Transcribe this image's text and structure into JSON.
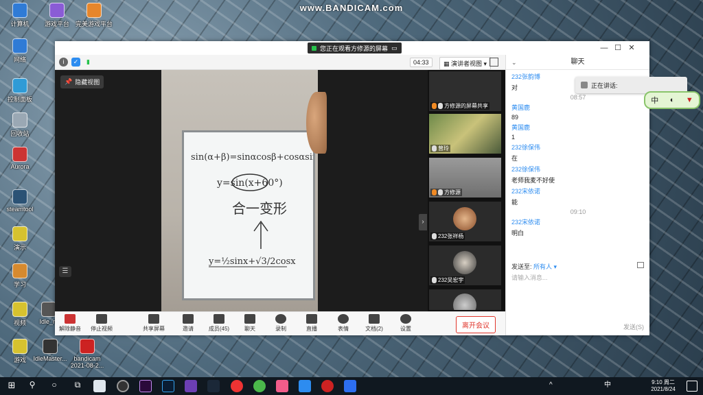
{
  "watermark": "www.BANDICAM.com",
  "desktop": {
    "icons": [
      {
        "label": "计算机",
        "color": "#2f7bd6"
      },
      {
        "label": "游戏平台",
        "color": "#8a5cd6"
      },
      {
        "label": "完美游戏平台",
        "color": "#e6862c"
      },
      {
        "label": "网络",
        "color": "#2f7bd6"
      },
      {
        "label": "控制面板",
        "color": "#2f9bd6"
      },
      {
        "label": "回收站",
        "color": "#9aa8b4"
      },
      {
        "label": "Aurora",
        "color": "#cc3333"
      },
      {
        "label": "steamtool",
        "color": "#2b5275"
      },
      {
        "label": "演示",
        "color": "#d6c22f"
      },
      {
        "label": "学习",
        "color": "#d68a2f"
      },
      {
        "label": "视频",
        "color": "#d6c22f"
      },
      {
        "label": "游戏",
        "color": "#d6c22f"
      },
      {
        "label": "Idle_m",
        "color": "#555555"
      },
      {
        "label": "IdleMaster...",
        "color": "#333333"
      },
      {
        "label": "bandicam 2021-08-2...",
        "color": "#cc2222"
      }
    ]
  },
  "window": {
    "share_banner": "您正在观看方修源的屏幕",
    "timer": "04:33",
    "view_button": "演讲者视图",
    "hide_button": "隐藏视图",
    "thumbnails": [
      {
        "label": "方修源的屏幕共享"
      },
      {
        "label": "曾玲"
      },
      {
        "label": "方修源"
      },
      {
        "label": "232张祥杨"
      },
      {
        "label": "232吴宏宇"
      },
      {
        "label": ""
      }
    ],
    "whiteboard_lines": [
      "sin(α+β)=sinαcosβ+cosαsinβ",
      "y=sin(x+60°)",
      "合一变形",
      "y=½sinx+√3/2cosx"
    ],
    "bottom_bar": {
      "mute": "解除静音",
      "video": "停止视频",
      "share": "共享屏幕",
      "invite": "邀请",
      "participants": "成员(45)",
      "chat": "聊天",
      "record": "录制",
      "live": "直播",
      "reactions": "表情",
      "docs": "文档(2)",
      "settings": "设置",
      "leave": "离开会议"
    }
  },
  "chat": {
    "title": "聊天",
    "messages": [
      {
        "type": "name",
        "text": "232张韵博"
      },
      {
        "type": "text",
        "text": "对"
      },
      {
        "type": "time",
        "text": "08:57"
      },
      {
        "type": "name",
        "text": "黄国鹿"
      },
      {
        "type": "text",
        "text": "89"
      },
      {
        "type": "name",
        "text": "黄国鹿"
      },
      {
        "type": "text",
        "text": "1"
      },
      {
        "type": "name",
        "text": "232徐保伟"
      },
      {
        "type": "text",
        "text": "在"
      },
      {
        "type": "name",
        "text": "232徐保伟"
      },
      {
        "type": "text",
        "text": "老师我麦不好使"
      },
      {
        "type": "name",
        "text": "232宋依诺"
      },
      {
        "type": "text",
        "text": "能"
      },
      {
        "type": "time",
        "text": "09:10"
      },
      {
        "type": "name",
        "text": "232宋依诺"
      },
      {
        "type": "text",
        "text": "明白"
      }
    ],
    "send_to_label": "发送至:",
    "send_to_value": "所有人",
    "input_placeholder": "请输入消息...",
    "send_button": "发送(S)"
  },
  "overlay": {
    "speaking": "正在讲话:",
    "ime": "中"
  },
  "taskbar": {
    "time": "9:10 周二",
    "date": "2021/8/24",
    "ime_indicator": "中"
  }
}
